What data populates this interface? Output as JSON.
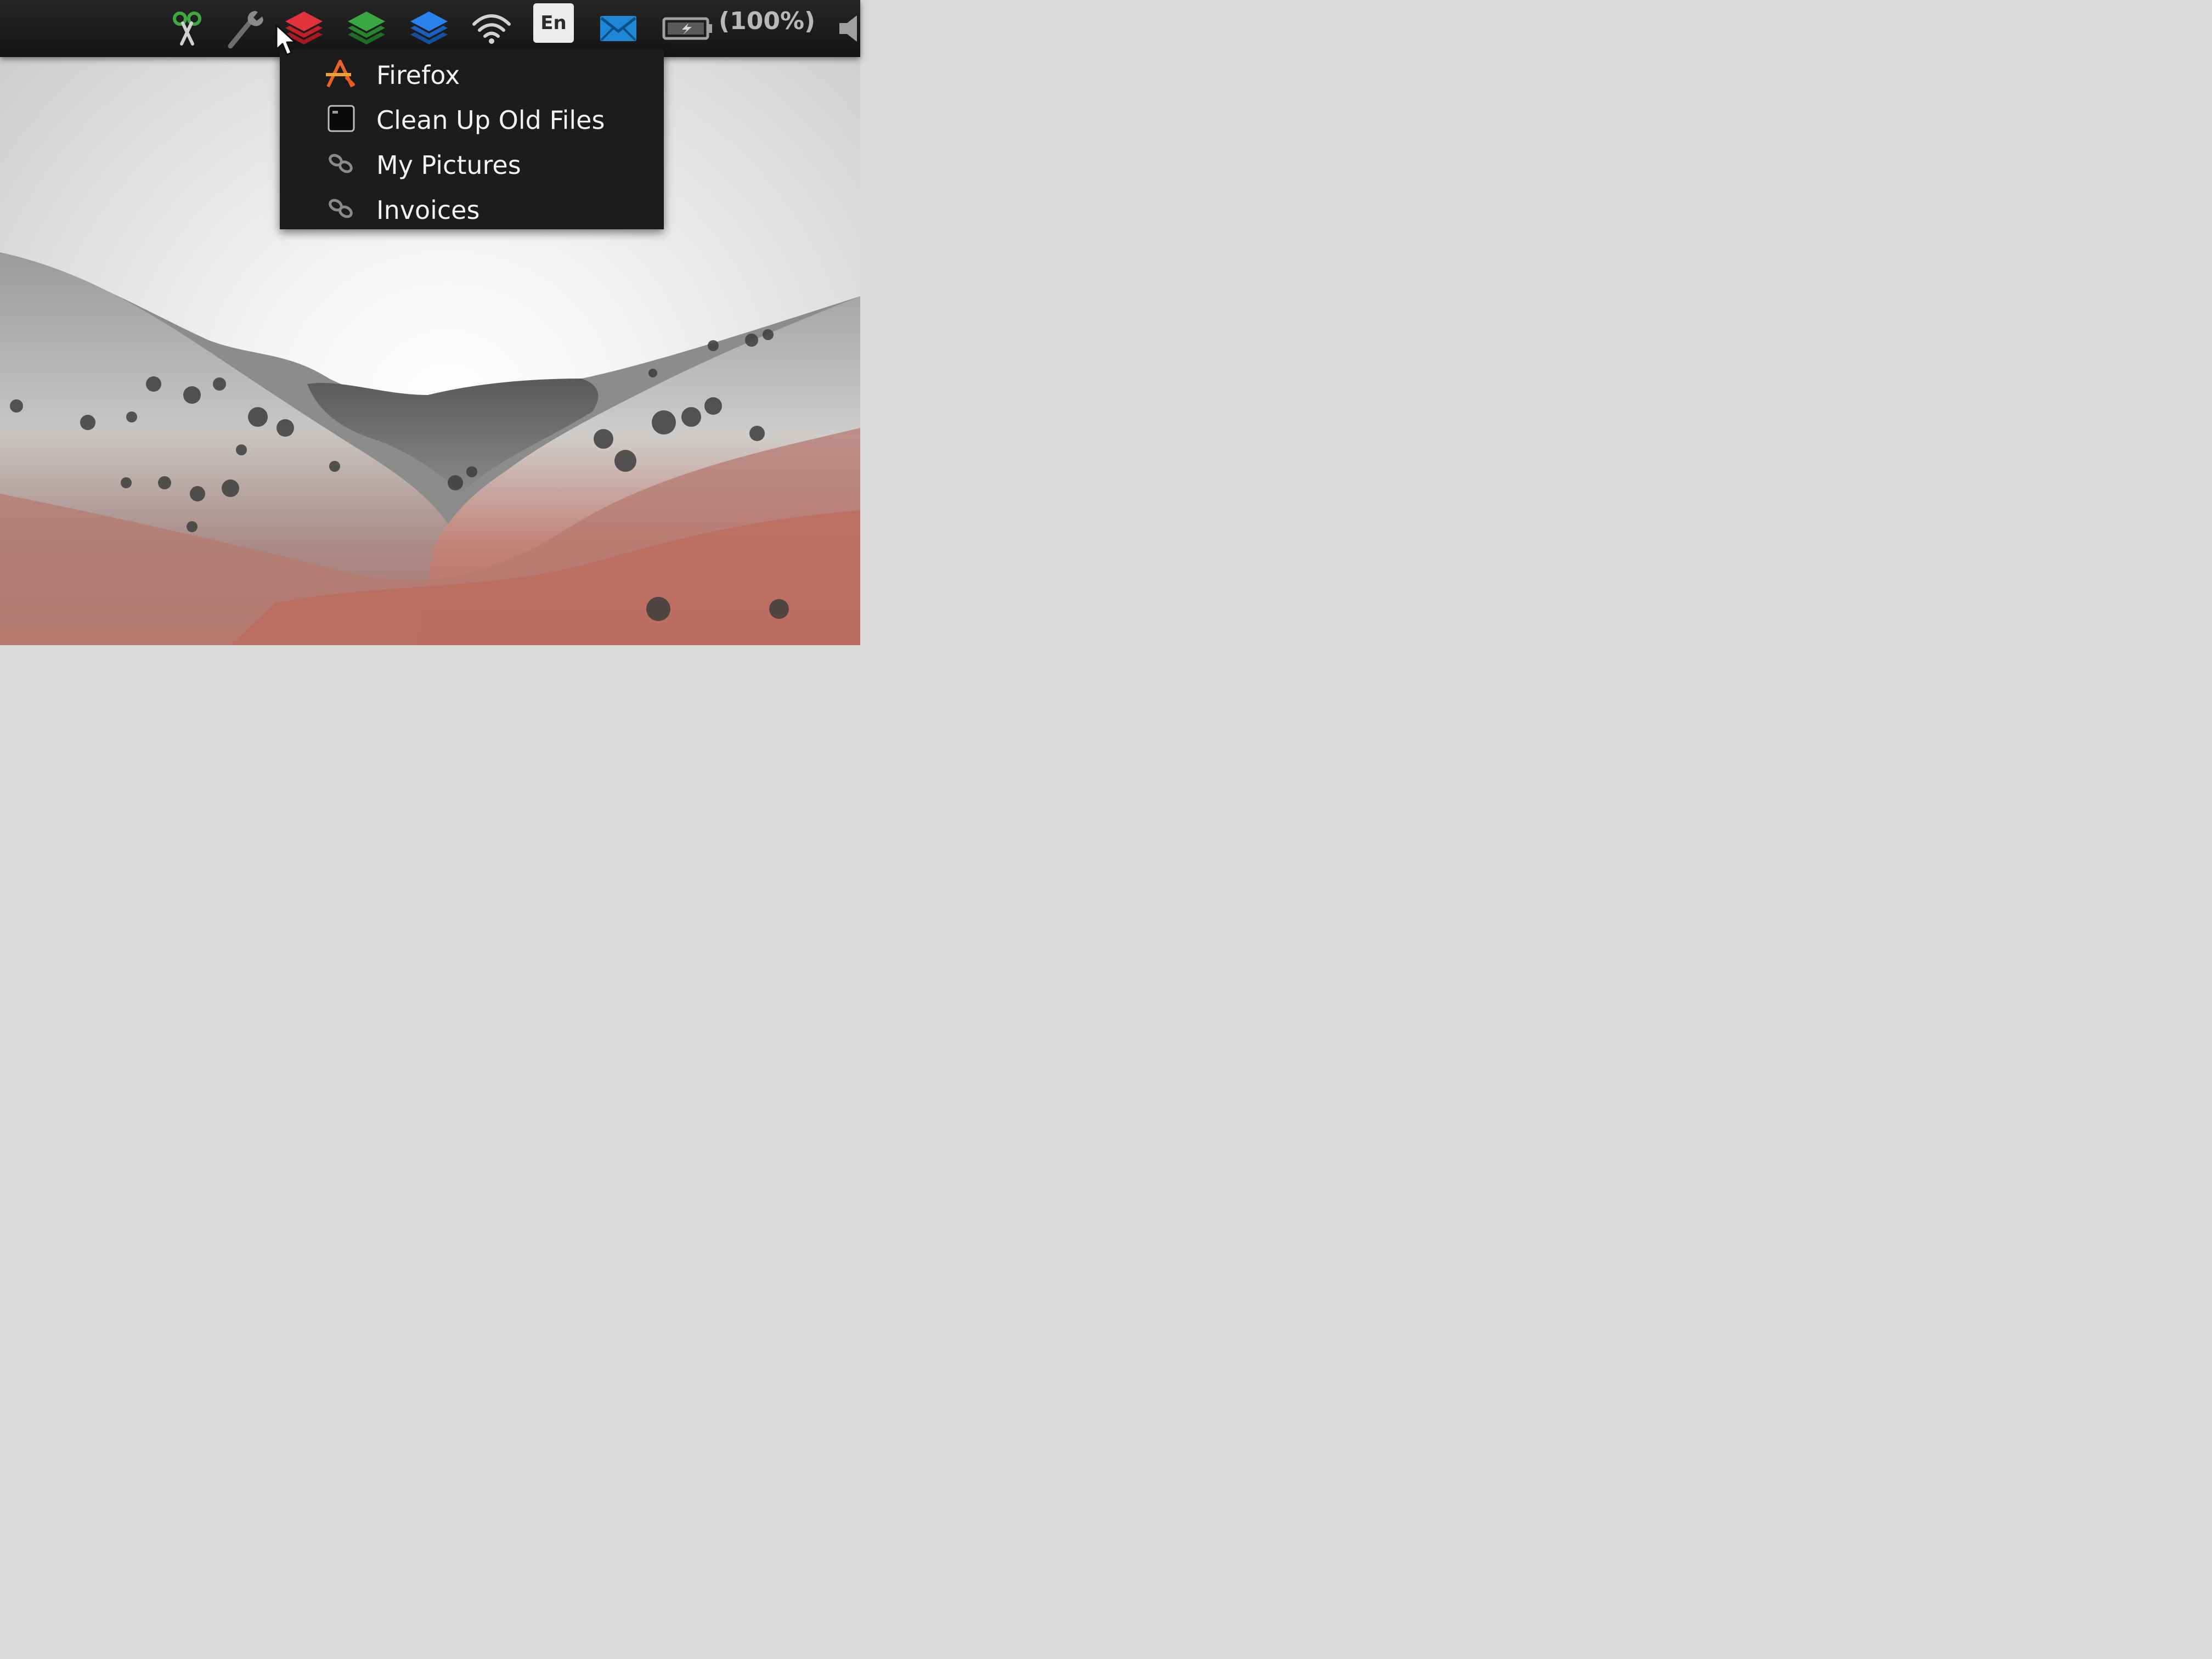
{
  "panel": {
    "tray_icons": [
      {
        "icon": "scissors-icon",
        "color": "#3fa93f"
      },
      {
        "icon": "wrench-icon",
        "color": "#7a7a7a"
      },
      {
        "icon": "stack-red-icon",
        "color": "#d8232d"
      },
      {
        "icon": "stack-green-icon",
        "color": "#2f9a34"
      },
      {
        "icon": "stack-blue-icon",
        "color": "#1f73d8"
      },
      {
        "icon": "wifi-icon",
        "color": "#cfcfcf"
      },
      {
        "icon": "mail-icon",
        "color": "#1e88d6"
      },
      {
        "icon": "battery-icon",
        "color": "#a0a0a0"
      },
      {
        "icon": "speaker-icon",
        "color": "#a0a0a0"
      }
    ],
    "language": "En",
    "battery_percent": "(100%)"
  },
  "menu": {
    "items": [
      {
        "label": "Firefox",
        "icon": "firefox-app-icon"
      },
      {
        "label": "Clean Up Old Files",
        "icon": "terminal-icon"
      },
      {
        "label": "My Pictures",
        "icon": "link-icon"
      },
      {
        "label": "Invoices",
        "icon": "link-icon"
      }
    ]
  }
}
